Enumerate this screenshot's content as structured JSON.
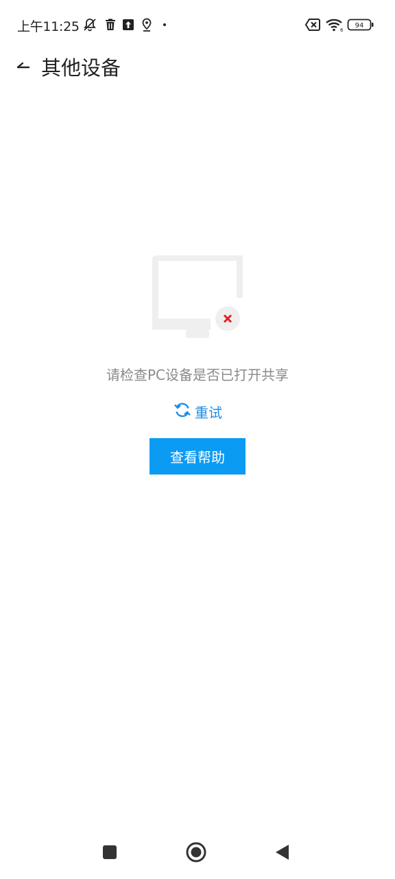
{
  "status_bar": {
    "time": "上午11:25",
    "battery_level": "94",
    "icons": [
      "bell-off-icon",
      "trash-icon",
      "upload-icon",
      "location-icon",
      "dot-icon",
      "sim-off-icon",
      "wifi-icon",
      "battery-icon"
    ]
  },
  "header": {
    "title": "其他设备",
    "back_icon": "back-arrow-icon"
  },
  "empty_state": {
    "illustration": "monitor-error-icon",
    "message": "请检查PC设备是否已打开共享",
    "retry_label": "重试",
    "help_button_label": "查看帮助"
  },
  "nav_bar": {
    "icons": [
      "recent-apps-icon",
      "home-icon",
      "back-icon"
    ]
  },
  "colors": {
    "accent": "#0c9bf3",
    "link": "#1e8ce6",
    "error": "#e02020",
    "muted_text": "#8a8a8a"
  }
}
